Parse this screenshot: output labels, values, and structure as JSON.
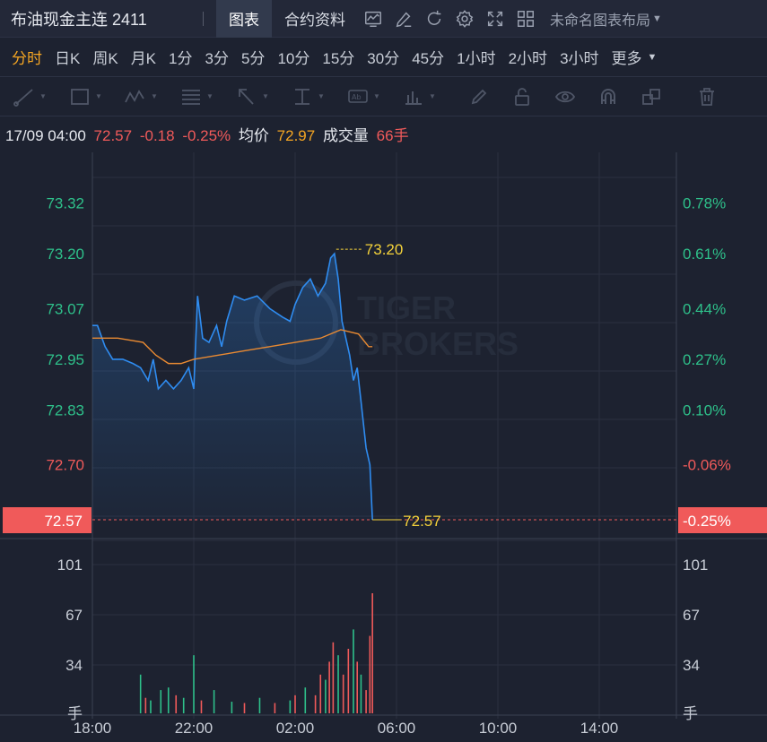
{
  "header": {
    "symbol_title": "布油现金主连 2411",
    "tabs": [
      {
        "label": "图表",
        "active": true
      },
      {
        "label": "合约资料",
        "active": false
      }
    ],
    "icons": [
      "indicator-icon",
      "draw-icon",
      "refresh-icon",
      "settings-icon",
      "fullscreen-icon",
      "layout-grid-icon"
    ],
    "layout_name": "未命名图表布局"
  },
  "periods": [
    {
      "label": "分时",
      "active": true
    },
    {
      "label": "日K"
    },
    {
      "label": "周K"
    },
    {
      "label": "月K"
    },
    {
      "label": "1分"
    },
    {
      "label": "3分"
    },
    {
      "label": "5分"
    },
    {
      "label": "10分"
    },
    {
      "label": "15分"
    },
    {
      "label": "30分"
    },
    {
      "label": "45分"
    },
    {
      "label": "1小时"
    },
    {
      "label": "2小时"
    },
    {
      "label": "3小时"
    },
    {
      "label": "更多",
      "dropdown": true
    }
  ],
  "drawing_tools": [
    "trend-line-icon",
    "rectangle-icon",
    "pattern-icon",
    "fib-icon",
    "arrow-icon",
    "measure-icon",
    "text-icon",
    "volume-profile-icon",
    "pen-icon",
    "lock-icon",
    "eye-icon",
    "magnet-icon",
    "clone-icon",
    "trash-icon"
  ],
  "info": {
    "datetime": "17/09 04:00",
    "price": "72.57",
    "change": "-0.18",
    "change_pct": "-0.25%",
    "avg_label": "均价",
    "avg_value": "72.97",
    "volume_label": "成交量",
    "volume_value": "66手"
  },
  "colors": {
    "price_line": "#2f8cf0",
    "avg_line": "#e98a32",
    "up": "#2ec08a",
    "down": "#f05a5a",
    "highlight": "#f5d33a"
  },
  "watermark": {
    "line1": "TIGER",
    "line2": "BROKERS"
  },
  "chart_data": {
    "type": "line",
    "x_ticks": [
      "18:00",
      "22:00",
      "02:00",
      "06:00",
      "10:00",
      "14:00"
    ],
    "price_ticks": [
      {
        "label": "73.32",
        "value": 73.32,
        "side": "up"
      },
      {
        "label": "73.20",
        "value": 73.2,
        "side": "up"
      },
      {
        "label": "73.07",
        "value": 73.07,
        "side": "up"
      },
      {
        "label": "72.95",
        "value": 72.95,
        "side": "up"
      },
      {
        "label": "72.83",
        "value": 72.83,
        "side": "up"
      },
      {
        "label": "72.70",
        "value": 72.7,
        "side": "down"
      }
    ],
    "pct_ticks": [
      {
        "label": "0.78%",
        "value": 73.32,
        "side": "up"
      },
      {
        "label": "0.61%",
        "value": 73.2,
        "side": "up"
      },
      {
        "label": "0.44%",
        "value": 73.07,
        "side": "up"
      },
      {
        "label": "0.27%",
        "value": 72.95,
        "side": "up"
      },
      {
        "label": "0.10%",
        "value": 72.83,
        "side": "up"
      },
      {
        "label": "-0.06%",
        "value": 72.7,
        "side": "down"
      }
    ],
    "current_price_label": "72.57",
    "current_pct_label": "-0.25%",
    "high_label": "73.20",
    "last_label": "72.57",
    "volume_ticks": [
      "101",
      "67",
      "34"
    ],
    "volume_unit": "手",
    "y_range": [
      72.57,
      73.44
    ],
    "volume_range": [
      0,
      134
    ],
    "price_series": [
      [
        18.0,
        73.03
      ],
      [
        18.2,
        73.03
      ],
      [
        18.5,
        72.98
      ],
      [
        18.8,
        72.95
      ],
      [
        19.2,
        72.95
      ],
      [
        19.6,
        72.94
      ],
      [
        19.9,
        72.93
      ],
      [
        20.2,
        72.9
      ],
      [
        20.4,
        72.95
      ],
      [
        20.6,
        72.88
      ],
      [
        20.9,
        72.9
      ],
      [
        21.2,
        72.88
      ],
      [
        21.5,
        72.9
      ],
      [
        21.8,
        72.93
      ],
      [
        22.0,
        72.88
      ],
      [
        22.15,
        73.1
      ],
      [
        22.35,
        73.0
      ],
      [
        22.6,
        72.99
      ],
      [
        22.9,
        73.03
      ],
      [
        23.1,
        72.98
      ],
      [
        23.3,
        73.04
      ],
      [
        23.6,
        73.1
      ],
      [
        24.0,
        73.09
      ],
      [
        24.5,
        73.1
      ],
      [
        25.0,
        73.07
      ],
      [
        25.5,
        73.05
      ],
      [
        25.8,
        73.04
      ],
      [
        26.0,
        73.08
      ],
      [
        26.3,
        73.12
      ],
      [
        26.6,
        73.14
      ],
      [
        26.9,
        73.1
      ],
      [
        27.2,
        73.13
      ],
      [
        27.4,
        73.19
      ],
      [
        27.55,
        73.2
      ],
      [
        27.7,
        73.14
      ],
      [
        27.85,
        73.04
      ],
      [
        28.0,
        73.0
      ],
      [
        28.15,
        72.96
      ],
      [
        28.3,
        72.9
      ],
      [
        28.45,
        72.93
      ],
      [
        28.6,
        72.85
      ],
      [
        28.8,
        72.74
      ],
      [
        28.95,
        72.7
      ],
      [
        29.05,
        72.57
      ]
    ],
    "avg_series": [
      [
        18.0,
        73.0
      ],
      [
        19.0,
        73.0
      ],
      [
        20.0,
        72.99
      ],
      [
        20.5,
        72.96
      ],
      [
        21.0,
        72.94
      ],
      [
        21.5,
        72.94
      ],
      [
        22.0,
        72.95
      ],
      [
        23.0,
        72.96
      ],
      [
        24.0,
        72.97
      ],
      [
        25.0,
        72.98
      ],
      [
        26.0,
        72.99
      ],
      [
        27.0,
        73.0
      ],
      [
        27.8,
        73.02
      ],
      [
        28.5,
        73.01
      ],
      [
        28.9,
        72.98
      ],
      [
        29.05,
        72.98
      ]
    ],
    "volume_series": [
      [
        19.9,
        30,
        "up"
      ],
      [
        20.1,
        12,
        "down"
      ],
      [
        20.3,
        10,
        "up"
      ],
      [
        20.7,
        18,
        "up"
      ],
      [
        21.0,
        20,
        "up"
      ],
      [
        21.3,
        14,
        "down"
      ],
      [
        21.6,
        12,
        "up"
      ],
      [
        22.0,
        45,
        "up"
      ],
      [
        22.3,
        10,
        "down"
      ],
      [
        22.8,
        18,
        "up"
      ],
      [
        23.5,
        9,
        "up"
      ],
      [
        24.0,
        8,
        "down"
      ],
      [
        24.6,
        12,
        "up"
      ],
      [
        25.2,
        8,
        "down"
      ],
      [
        25.8,
        10,
        "up"
      ],
      [
        26.0,
        14,
        "down"
      ],
      [
        26.4,
        20,
        "up"
      ],
      [
        26.8,
        14,
        "down"
      ],
      [
        27.0,
        30,
        "down"
      ],
      [
        27.2,
        26,
        "up"
      ],
      [
        27.35,
        40,
        "down"
      ],
      [
        27.5,
        55,
        "down"
      ],
      [
        27.7,
        45,
        "up"
      ],
      [
        27.9,
        30,
        "down"
      ],
      [
        28.1,
        50,
        "down"
      ],
      [
        28.3,
        65,
        "up"
      ],
      [
        28.45,
        40,
        "down"
      ],
      [
        28.6,
        30,
        "up"
      ],
      [
        28.8,
        18,
        "down"
      ],
      [
        28.95,
        60,
        "down"
      ],
      [
        29.05,
        93,
        "down"
      ]
    ]
  }
}
